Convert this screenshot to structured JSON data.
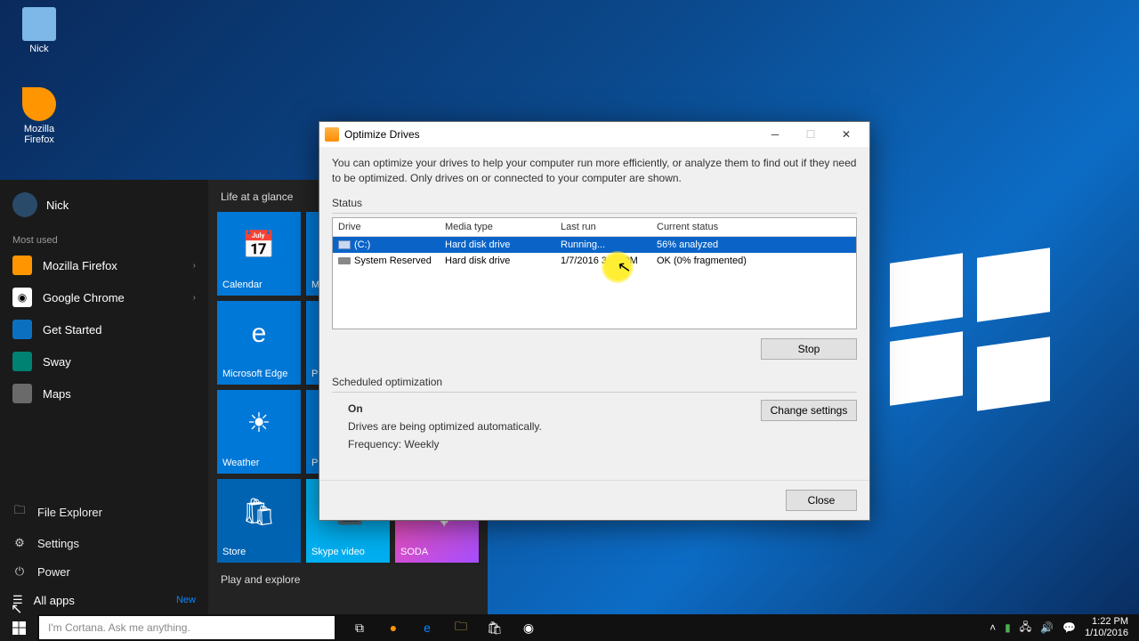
{
  "desktop": {
    "icons": [
      "Nick",
      "Mozilla Firefox",
      ""
    ]
  },
  "start": {
    "user": "Nick",
    "most_used_label": "Most used",
    "apps": [
      {
        "label": "Mozilla Firefox",
        "chevron": "›"
      },
      {
        "label": "Google Chrome",
        "chevron": "›"
      },
      {
        "label": "Get Started",
        "chevron": ""
      },
      {
        "label": "Sway",
        "chevron": ""
      },
      {
        "label": "Maps",
        "chevron": ""
      }
    ],
    "sys": {
      "file_explorer": "File Explorer",
      "settings": "Settings",
      "power": "Power",
      "all_apps": "All apps",
      "new": "New"
    },
    "right": {
      "glance": "Life at a glance",
      "calendar": "Calendar",
      "mail": "M",
      "edge": "Microsoft Edge",
      "people": "P",
      "weather": "Weather",
      "phone": "P",
      "play": "Play and explore",
      "store": "Store",
      "skype": "Skype video",
      "soda": "SODA"
    }
  },
  "taskbar": {
    "cortana": "I'm Cortana. Ask me anything.",
    "time": "1:22 PM",
    "date": "1/10/2016"
  },
  "dialog": {
    "title": "Optimize Drives",
    "desc": "You can optimize your drives to help your computer run more efficiently, or analyze them to find out if they need to be optimized. Only drives on or connected to your computer are shown.",
    "status_label": "Status",
    "cols": {
      "drive": "Drive",
      "media": "Media type",
      "last": "Last run",
      "current": "Current status"
    },
    "rows": [
      {
        "drive": "(C:)",
        "media": "Hard disk drive",
        "last": "Running...",
        "status": "56% analyzed"
      },
      {
        "drive": "System Reserved",
        "media": "Hard disk drive",
        "last": "1/7/2016 3:04 PM",
        "status": "OK (0% fragmented)"
      }
    ],
    "stop": "Stop",
    "sched": {
      "title": "Scheduled optimization",
      "on": "On",
      "msg": "Drives are being optimized automatically.",
      "freq": "Frequency: Weekly",
      "change": "Change settings"
    },
    "close": "Close"
  }
}
